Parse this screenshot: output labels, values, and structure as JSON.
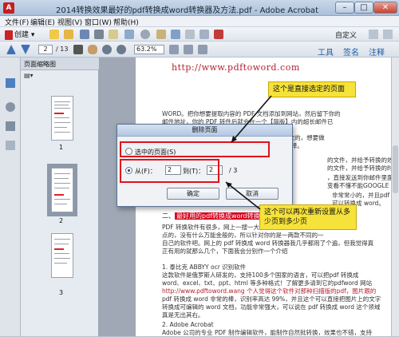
{
  "window": {
    "app_icon_text": "A",
    "title": "2014转换效果最好的pdf转换成word转换器及方法.pdf - Adobe Acrobat Pro",
    "min_symbol": "–",
    "max_symbol": "□",
    "close_symbol": "✕"
  },
  "menubar": {
    "items": [
      "文件(F)",
      "编辑(E)",
      "视图(V)",
      "窗口(W)",
      "帮助(H)"
    ]
  },
  "toolbar1": {
    "create_label": "创建",
    "customize_label": "自定义"
  },
  "toolbar2": {
    "page_current": "2",
    "page_total": "/ 13",
    "zoom": "63.2%",
    "tools_label": "工具",
    "sign_label": "签名",
    "comment_label": "注释"
  },
  "thumbnail_panel": {
    "title": "页面缩略图",
    "pages": [
      "1",
      "2",
      "3"
    ]
  },
  "document": {
    "url_text": "http://www.pdftoword.com",
    "lines_top": [
      "WORD。把你想要提取内容的 PDF 文档添加到网站，然后留下你的",
      "邮件地址，你的 PDF 转件后就会在一个【简版】内的超长邮件已",
      "的复制出所有的内容了，非常的方便。",
      "PS：以前网上也很多人推荐多Gmail，那是一次次的，想要做",
      "不好用，既然接在QQ邮箱这么好，当时也推荐选择。"
    ],
    "lines_right": [
      "的文件，并给予转换的效果，",
      "的文件，并给予转换的时。",
      "，直接发送到你邮件里面",
      "变看不懂不能GOOGLE"
    ],
    "lines_right2": [
      "非常常小的，并且pdf",
      "可以转换成 word。",
      "转换的"
    ],
    "headline_prefix": "二、",
    "headline_highlight": "最好用的pdf转换成word转换器",
    "body_lines": [
      "PDF 转换软件有很多，网上一搜一大把，但是我们是需要转",
      "点的，没有什么万能金般的，所以针对你的是一两款不同的一",
      "自己的软件吧。网上的 pdf 转换成 word 转换器我几乎都用了个遍，但我觉得真",
      "正有用的就那么几个，下面我会分别作一个介绍",
      "",
      "1. 泰比克 ABBYY ocr 识别软件",
      "这款软件是俄罗斯人研发的，支持100多个国家的语言，可以把pdf 转换成",
      "word、excel、txt、ppt、html 等多种格式！了解更多请到它的pdfword 网站",
      "http://www.pdftoword.wang 个人觉得这个软件对那种扫描版的pdf，图片跟的",
      "pdf 转换成 word 非常的棒，识别率高达 99%，并且这个可以直接把图片上的文字",
      "转换成可编辑的 word 文档，功能非常强大，可以说在 pdf 转换成 word 这个领域",
      "真是无出其右。",
      "",
      "2. Adobe Acrobat",
      "Adobe 公司的专业 PDF 制作编辑软件，能制作自然批转换，效果也不错，支持"
    ]
  },
  "dialog": {
    "title": "删除页面",
    "option_selected_pages": "选中的页面(S)",
    "option_from_label": "从(F)：",
    "from_value": "2",
    "to_label": "到(T)：",
    "to_value": "2",
    "total": "/ 3",
    "ok_label": "确定",
    "cancel_label": "取消"
  },
  "annotations": {
    "callout_top": "这个是直接选定的页面",
    "callout_bottom": "这个可以再次重新设置从多少页到多少页"
  },
  "colors": {
    "annotation_red": "#e3111c",
    "callout_yellow": "#f5e23a",
    "url_red": "#b3212f"
  }
}
